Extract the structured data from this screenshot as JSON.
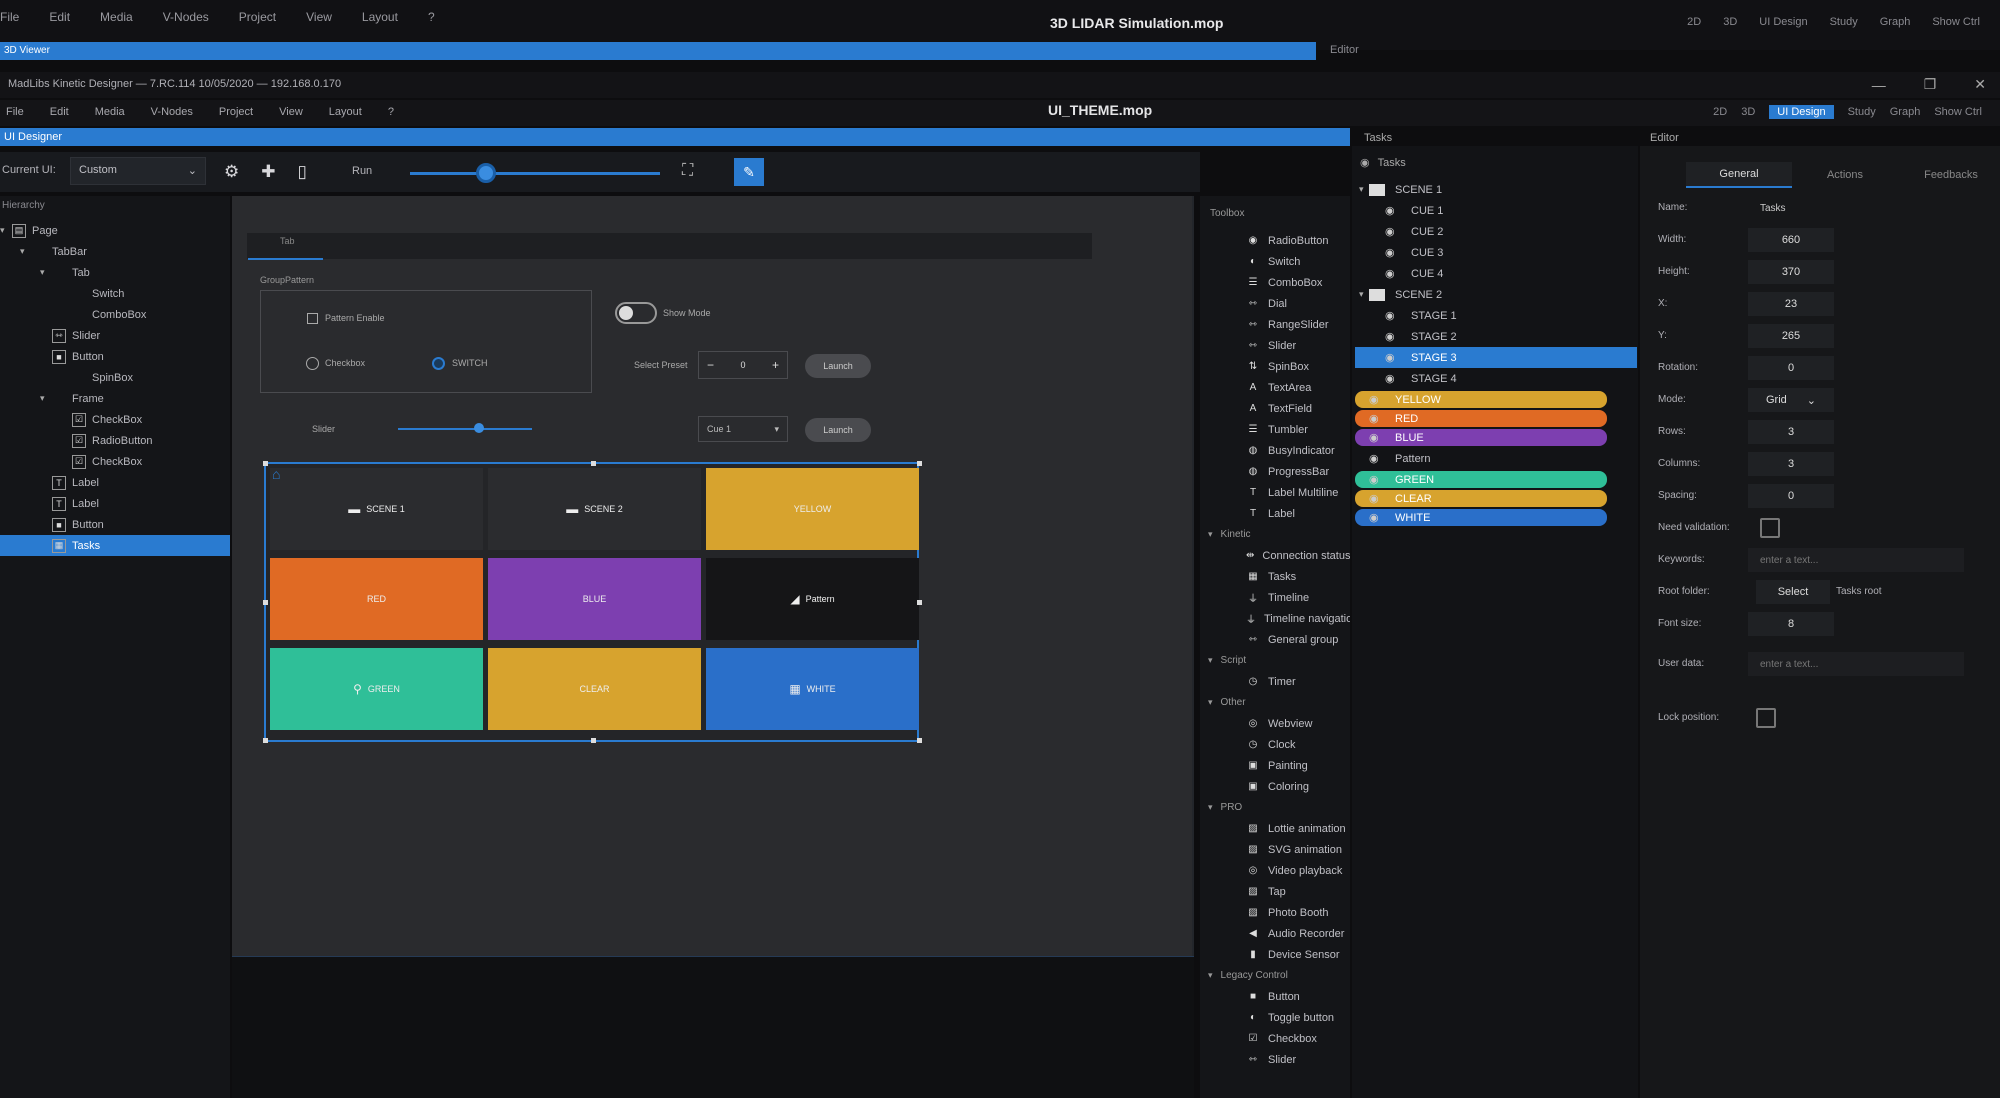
{
  "outer_window": {
    "title": "3D LIDAR Simulation.mop",
    "menu": [
      "File",
      "Edit",
      "Media",
      "V-Nodes",
      "Project",
      "View",
      "Layout",
      "?"
    ],
    "right_modes": [
      "2D",
      "3D",
      "UI Design",
      "Study",
      "Graph",
      "Show Ctrl"
    ],
    "bluebar_label": "3D Viewer",
    "editor_label": "Editor"
  },
  "inner_window": {
    "title_text": "MadLibs Kinetic Designer — 7.RC.114 10/05/2020 — 192.168.0.170",
    "menu": [
      "File",
      "Edit",
      "Media",
      "V-Nodes",
      "Project",
      "View",
      "Layout",
      "?"
    ],
    "title": "UI_THEME.mop",
    "right_modes": [
      "2D",
      "3D",
      "UI Design",
      "Study",
      "Graph",
      "Show Ctrl"
    ],
    "active_mode": "UI Design",
    "ui_designer_label": "UI Designer",
    "tasks_label": "Tasks",
    "editor_label": "Editor",
    "window_controls": [
      "—",
      "❐",
      "✕"
    ]
  },
  "toolbar": {
    "current_ui_label": "Current UI:",
    "current_ui_value": "Custom",
    "run_label": "Run",
    "slider_value": 0.3
  },
  "hierarchy": {
    "label": "Hierarchy",
    "items": [
      {
        "label": "Page",
        "level": 0,
        "caret": "▾",
        "icon": "▤"
      },
      {
        "label": "TabBar",
        "level": 1,
        "caret": "▾",
        "icon": ""
      },
      {
        "label": "Tab",
        "level": 2,
        "caret": "▾",
        "icon": ""
      },
      {
        "label": "Switch",
        "level": 3,
        "caret": "",
        "icon": ""
      },
      {
        "label": "ComboBox",
        "level": 3,
        "caret": "",
        "icon": ""
      },
      {
        "label": "Slider",
        "level": 2,
        "caret": "",
        "icon": "⇿"
      },
      {
        "label": "Button",
        "level": 2,
        "caret": "",
        "icon": "■"
      },
      {
        "label": "SpinBox",
        "level": 3,
        "caret": "",
        "icon": ""
      },
      {
        "label": "Frame",
        "level": 2,
        "caret": "▾",
        "icon": ""
      },
      {
        "label": "CheckBox",
        "level": 3,
        "caret": "",
        "icon": "☑"
      },
      {
        "label": "RadioButton",
        "level": 3,
        "caret": "",
        "icon": "☑"
      },
      {
        "label": "CheckBox",
        "level": 3,
        "caret": "",
        "icon": "☑"
      },
      {
        "label": "Label",
        "level": 2,
        "caret": "",
        "icon": "T"
      },
      {
        "label": "Label",
        "level": 2,
        "caret": "",
        "icon": "T"
      },
      {
        "label": "Button",
        "level": 2,
        "caret": "",
        "icon": "■"
      },
      {
        "label": "Tasks",
        "level": 2,
        "caret": "",
        "icon": "▦",
        "selected": true
      }
    ]
  },
  "canvas": {
    "tab_label": "Tab",
    "group_label": "GroupPattern",
    "checkbox_label": "Pattern Enable",
    "radio1_label": "Checkbox",
    "radio2_label": "SWITCH",
    "switch_label": "Show Mode",
    "stepper_label": "Select Preset",
    "stepper_value": "0",
    "button_label": "Launch",
    "slider_label": "Slider",
    "slider_value": 0.6,
    "combo_value": "Cue 1",
    "button2_label": "Launch",
    "tiles": [
      {
        "label": "SCENE 1",
        "color": "#2b2c2f",
        "icon": "folder"
      },
      {
        "label": "SCENE 2",
        "color": "#2b2c2f",
        "icon": "folder"
      },
      {
        "label": "YELLOW",
        "color": "#d7a32e",
        "icon": ""
      },
      {
        "label": "RED",
        "color": "#e06a24",
        "icon": ""
      },
      {
        "label": "BLUE",
        "color": "#7d3fb0",
        "icon": ""
      },
      {
        "label": "Pattern",
        "color": "#151517",
        "icon": "pattern"
      },
      {
        "label": "GREEN",
        "color": "#2fbf98",
        "icon": "bulb"
      },
      {
        "label": "CLEAR",
        "color": "#d7a32e",
        "icon": ""
      },
      {
        "label": "WHITE",
        "color": "#2a6fc9",
        "icon": "grid"
      }
    ]
  },
  "toolbox": {
    "label": "Toolbox",
    "sections": [
      {
        "category": "",
        "items": [
          {
            "label": "RadioButton",
            "icon": "◉"
          },
          {
            "label": "Switch",
            "icon": "◐"
          },
          {
            "label": "ComboBox",
            "icon": "☰"
          },
          {
            "label": "Dial",
            "icon": "⇿"
          },
          {
            "label": "RangeSlider",
            "icon": "⇿"
          },
          {
            "label": "Slider",
            "icon": "⇿"
          },
          {
            "label": "SpinBox",
            "icon": "⇅"
          },
          {
            "label": "TextArea",
            "icon": "A"
          },
          {
            "label": "TextField",
            "icon": "A"
          },
          {
            "label": "Tumbler",
            "icon": "☰"
          },
          {
            "label": "BusyIndicator",
            "icon": "◍"
          },
          {
            "label": "ProgressBar",
            "icon": "◍"
          },
          {
            "label": "Label Multiline",
            "icon": "T"
          },
          {
            "label": "Label",
            "icon": "T"
          }
        ]
      },
      {
        "category": "Kinetic",
        "items": [
          {
            "label": "Connection status",
            "icon": "⇹"
          },
          {
            "label": "Tasks",
            "icon": "▦"
          },
          {
            "label": "Timeline",
            "icon": "⏚"
          },
          {
            "label": "Timeline navigation",
            "icon": "⏚"
          },
          {
            "label": "General group",
            "icon": "⇿"
          }
        ]
      },
      {
        "category": "Script",
        "items": [
          {
            "label": "Timer",
            "icon": "◷"
          }
        ]
      },
      {
        "category": "Other",
        "items": [
          {
            "label": "Webview",
            "icon": "◎"
          },
          {
            "label": "Clock",
            "icon": "◷"
          },
          {
            "label": "Painting",
            "icon": "▣"
          },
          {
            "label": "Coloring",
            "icon": "▣"
          }
        ]
      },
      {
        "category": "PRO",
        "items": [
          {
            "label": "Lottie animation",
            "icon": "▨"
          },
          {
            "label": "SVG animation",
            "icon": "▨"
          },
          {
            "label": "Video playback",
            "icon": "◎"
          },
          {
            "label": "Tap",
            "icon": "▨"
          },
          {
            "label": "Photo Booth",
            "icon": "▨"
          },
          {
            "label": "Audio Recorder",
            "icon": "◀"
          },
          {
            "label": "Device Sensor",
            "icon": "▮"
          }
        ]
      },
      {
        "category": "Legacy Control",
        "items": [
          {
            "label": "Button",
            "icon": "■"
          },
          {
            "label": "Toggle button",
            "icon": "◐"
          },
          {
            "label": "Checkbox",
            "icon": "☑"
          },
          {
            "label": "Slider",
            "icon": "⇿"
          }
        ]
      }
    ]
  },
  "tasks_panel": {
    "header": "Tasks",
    "rows": [
      {
        "label": "SCENE 1",
        "type": "folder",
        "caret": "▾"
      },
      {
        "label": "CUE 1",
        "type": "item"
      },
      {
        "label": "CUE 2",
        "type": "item"
      },
      {
        "label": "CUE 3",
        "type": "item"
      },
      {
        "label": "CUE 4",
        "type": "item"
      },
      {
        "label": "SCENE 2",
        "type": "folder",
        "caret": "▾"
      },
      {
        "label": "STAGE 1",
        "type": "item"
      },
      {
        "label": "STAGE 2",
        "type": "item"
      },
      {
        "label": "STAGE 3",
        "type": "item",
        "selected": true
      },
      {
        "label": "STAGE 4",
        "type": "item"
      },
      {
        "label": "YELLOW",
        "type": "colored",
        "color": "#d7a32e"
      },
      {
        "label": "RED",
        "type": "colored",
        "color": "#e06a24"
      },
      {
        "label": "BLUE",
        "type": "colored",
        "color": "#7d3fb0"
      },
      {
        "label": "Pattern",
        "type": "plain"
      },
      {
        "label": "GREEN",
        "type": "colored",
        "color": "#2fbf98"
      },
      {
        "label": "CLEAR",
        "type": "colored",
        "color": "#d7a32e"
      },
      {
        "label": "WHITE",
        "type": "colored",
        "color": "#2a6fc9"
      }
    ]
  },
  "editor_panel": {
    "tabs": [
      "General",
      "Actions",
      "Feedbacks"
    ],
    "active_tab": "General",
    "props": [
      {
        "label": "Name:",
        "value": "Tasks",
        "kind": "name"
      },
      {
        "label": "Width:",
        "value": "660",
        "kind": "box"
      },
      {
        "label": "Height:",
        "value": "370",
        "kind": "box"
      },
      {
        "label": "X:",
        "value": "23",
        "kind": "box"
      },
      {
        "label": "Y:",
        "value": "265",
        "kind": "box"
      },
      {
        "label": "Rotation:",
        "value": "0",
        "kind": "box"
      },
      {
        "label": "Mode:",
        "value": "Grid",
        "kind": "select"
      },
      {
        "label": "Rows:",
        "value": "3",
        "kind": "box"
      },
      {
        "label": "Columns:",
        "value": "3",
        "kind": "box"
      },
      {
        "label": "Spacing:",
        "value": "0",
        "kind": "box"
      },
      {
        "label": "Need validation:",
        "value": "",
        "kind": "check"
      },
      {
        "label": "Keywords:",
        "value": "enter a text...",
        "kind": "wide"
      },
      {
        "label": "Root folder:",
        "value": "Select",
        "kind": "root",
        "extra": "Tasks root"
      },
      {
        "label": "Font size:",
        "value": "8",
        "kind": "box"
      },
      {
        "label": "User data:",
        "value": "enter a text...",
        "kind": "wide"
      },
      {
        "label": "Lock position:",
        "value": "",
        "kind": "check"
      }
    ]
  },
  "colors": {
    "accent": "#2a7bd0",
    "background": "#0d0d0f",
    "panel": "#141518",
    "canvas": "#2a2b2e"
  }
}
